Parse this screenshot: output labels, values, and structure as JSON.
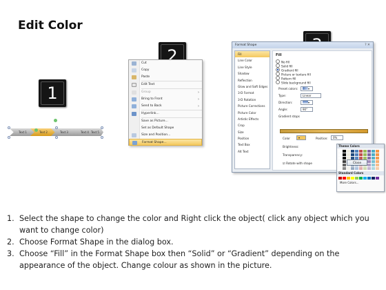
{
  "slide": {
    "title": "Edit Color",
    "badges": [
      "1",
      "2",
      "3"
    ]
  },
  "shape_strip": {
    "labels": [
      "Text 1",
      "Text 2",
      "Text 3",
      "Text 4",
      "Text 5"
    ],
    "selected_index": 1
  },
  "context_menu": {
    "items": [
      {
        "label": "Cut",
        "disabled": false
      },
      {
        "label": "Copy",
        "disabled": false
      },
      {
        "label": "Paste",
        "disabled": false
      },
      {
        "label": "Edit Text",
        "disabled": false
      },
      {
        "label": "Group",
        "disabled": true
      },
      {
        "label": "Bring to Front",
        "disabled": false
      },
      {
        "label": "Send to Back",
        "disabled": false
      },
      {
        "label": "Hyperlink...",
        "disabled": false
      },
      {
        "label": "Save as Picture...",
        "disabled": false
      },
      {
        "label": "Set as Default Shape",
        "disabled": false
      },
      {
        "label": "Size and Position...",
        "disabled": false
      },
      {
        "label": "Format Shape...",
        "disabled": false,
        "highlighted": true
      }
    ]
  },
  "format_dialog": {
    "title": "Format Shape",
    "close_glyph": "? ✕",
    "nav": [
      "Fill",
      "Line Color",
      "Line Style",
      "Shadow",
      "Reflection",
      "Glow and Soft Edges",
      "3-D Format",
      "3-D Rotation",
      "Picture Corrections",
      "Picture Color",
      "Artistic Effects",
      "Crop",
      "Size",
      "Position",
      "Text Box",
      "Alt Text"
    ],
    "section": "Fill",
    "fill_options": [
      "No fill",
      "Solid fill",
      "Gradient fill",
      "Picture or texture fill",
      "Pattern fill",
      "Slide background fill"
    ],
    "selected_fill": "Gradient fill",
    "preset_label": "Preset colors:",
    "type_label": "Type:",
    "type_value": "Linear",
    "direction_label": "Direction:",
    "angle_label": "Angle:",
    "angle_value": "90°",
    "stops_label": "Gradient stops",
    "color_label": "Color",
    "position_label": "Position:",
    "position_value": "0%",
    "brightness_label": "Brightness:",
    "transparency_label": "Transparency:",
    "rotate_label": "Rotate with shape",
    "theme_colors_label": "Theme Colors",
    "standard_colors_label": "Standard Colors",
    "more_colors_label": "More Colors...",
    "close_label": "Close",
    "accent": "#f4c85f"
  },
  "instructions": [
    {
      "num": "1.",
      "text": "Select the shape to change the color and Right click the object( click any object which you want to change color)"
    },
    {
      "num": "2.",
      "text": "Choose Format Shape in the dialog box."
    },
    {
      "num": "3.",
      "text": "Choose “Fill” in the Format Shape box then “Solid” or “Gradient” depending on the appearance of the object. Change colour as shown in the picture."
    }
  ]
}
